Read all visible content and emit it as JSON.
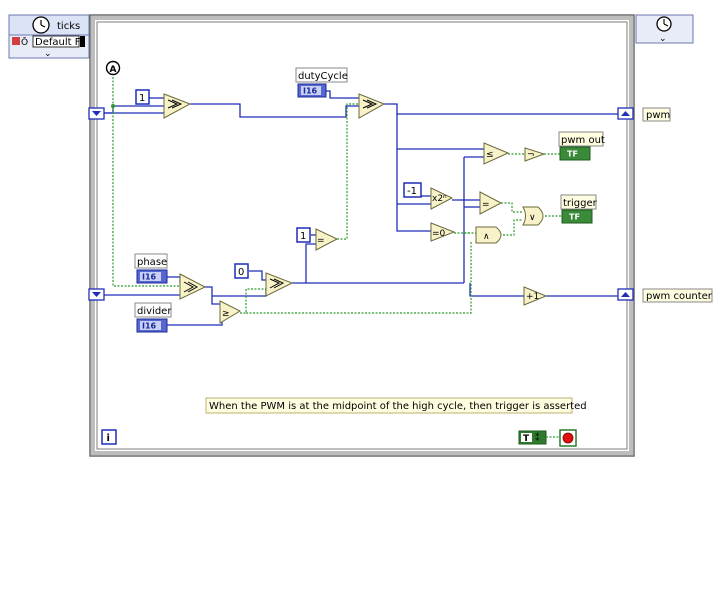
{
  "top_left": {
    "label": "ticks",
    "selector_value": "Default F"
  },
  "loop": {
    "iteration_terminal": "i"
  },
  "constants": {
    "one_a": "1",
    "minus_one": "-1",
    "one_b": "1",
    "zero": "0",
    "true_const": "T"
  },
  "controls": {
    "duty_cycle": {
      "label": "dutyCycle",
      "type": "I16"
    },
    "phase": {
      "label": "phase",
      "type": "I16"
    },
    "divider": {
      "label": "divider",
      "type": "I16"
    }
  },
  "indicators": {
    "pwm_out": {
      "label": "pwm out",
      "type": "TF"
    },
    "trigger": {
      "label": "trigger",
      "type": "TF"
    }
  },
  "shift_outputs": {
    "pwm": "pwm",
    "pwm_counter": "pwm counter"
  },
  "comment": "When the PWM is at the midpoint of the high cycle, then trigger is asserted",
  "colors": {
    "loop_border": "#7e7e7e",
    "int_wire": "#1f2fb8",
    "bool_wire": "#2f9a2f",
    "function_fill": "#f8f2c8",
    "label_fill": "#fffde0",
    "control_fill": "#5866d0",
    "indicator_fill": "#3a8a3a"
  }
}
